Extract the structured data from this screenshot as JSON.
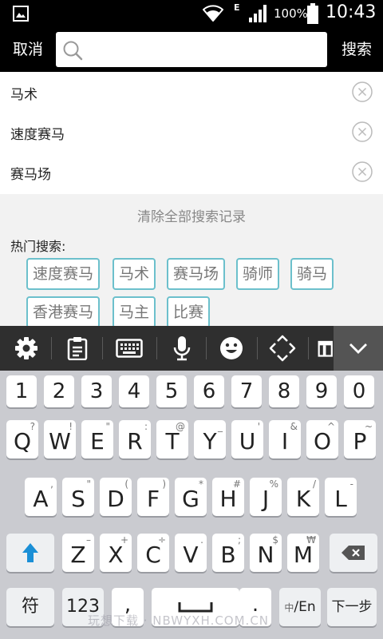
{
  "status_bar": {
    "network_type": "E",
    "battery_percent": "100%",
    "time": "10:43"
  },
  "search_header": {
    "cancel_label": "取消",
    "search_label": "搜索",
    "query": "",
    "placeholder": ""
  },
  "history": [
    {
      "label": "马术"
    },
    {
      "label": "速度赛马"
    },
    {
      "label": "赛马场"
    }
  ],
  "clear_history_label": "清除全部搜索记录",
  "hot_search": {
    "title": "热门搜索:",
    "tags": [
      "速度赛马",
      "马术",
      "赛马场",
      "骑师",
      "骑马",
      "香港赛马",
      "马主",
      "比赛"
    ]
  },
  "keyboard_toolbar": {
    "icons": [
      "gear-icon",
      "clipboard-icon",
      "keyboard-icon",
      "microphone-icon",
      "emoji-icon",
      "cursor-move-icon",
      "text-edit-icon",
      "collapse-chevron-icon"
    ]
  },
  "keyboard": {
    "number_row": [
      "1",
      "2",
      "3",
      "4",
      "5",
      "6",
      "7",
      "8",
      "9",
      "0"
    ],
    "row1": [
      {
        "key": "Q",
        "sub": "?"
      },
      {
        "key": "W",
        "sub": "!"
      },
      {
        "key": "E",
        "sub": "\""
      },
      {
        "key": "R",
        "sub": ":"
      },
      {
        "key": "T",
        "sub": "@"
      },
      {
        "key": "Y",
        "sub": "_"
      },
      {
        "key": "U",
        "sub": "'"
      },
      {
        "key": "I",
        "sub": "&"
      },
      {
        "key": "O",
        "sub": "^"
      },
      {
        "key": "P",
        "sub": "~"
      }
    ],
    "row2": [
      {
        "key": "A",
        "sub": ","
      },
      {
        "key": "S",
        "sub": "\""
      },
      {
        "key": "D",
        "sub": "("
      },
      {
        "key": "F",
        "sub": ")"
      },
      {
        "key": "G",
        "sub": "*"
      },
      {
        "key": "H",
        "sub": "#"
      },
      {
        "key": "J",
        "sub": "%"
      },
      {
        "key": "K",
        "sub": "/"
      },
      {
        "key": "L",
        "sub": "-"
      }
    ],
    "row3": [
      {
        "key": "Z",
        "sub": "–"
      },
      {
        "key": "X",
        "sub": "+"
      },
      {
        "key": "C",
        "sub": "÷"
      },
      {
        "key": "V",
        "sub": "."
      },
      {
        "key": "B",
        "sub": ";"
      },
      {
        "key": "N",
        "sub": "$"
      },
      {
        "key": "M",
        "sub": "₩"
      }
    ],
    "symbols_label": "符",
    "numbers_label": "123",
    "comma_label": ",",
    "period_label": ".",
    "lang_label_cn": "中",
    "lang_label_en": "/En",
    "next_label": "下一步"
  },
  "watermark": "玩想下载 · NBWYXH.COM.CN"
}
